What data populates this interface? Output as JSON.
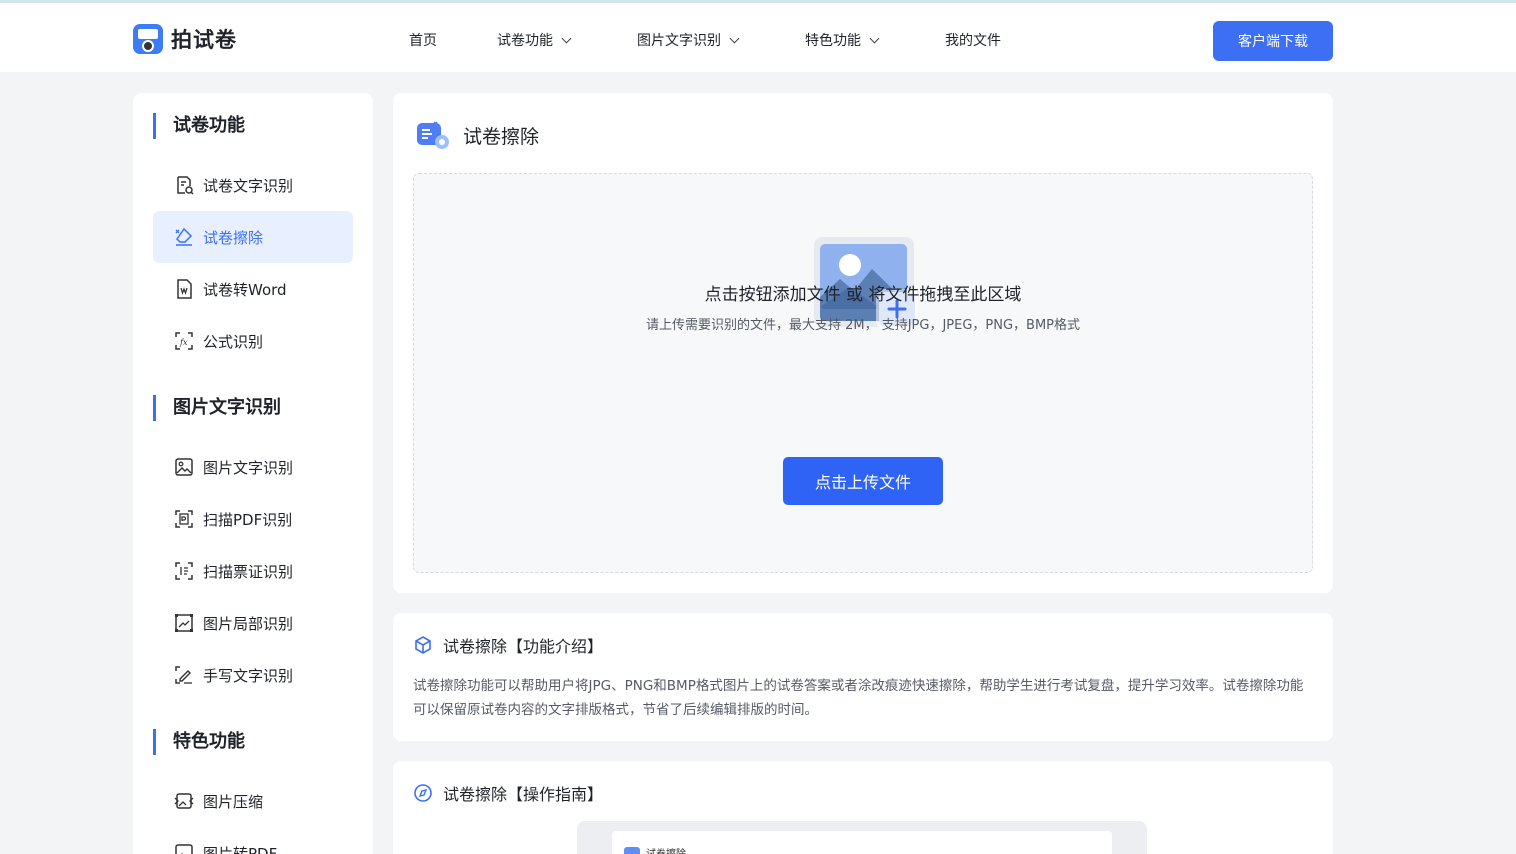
{
  "header": {
    "logo_text": "拍试卷",
    "nav": [
      {
        "label": "首页",
        "has_dropdown": false
      },
      {
        "label": "试卷功能",
        "has_dropdown": true
      },
      {
        "label": "图片文字识别",
        "has_dropdown": true
      },
      {
        "label": "特色功能",
        "has_dropdown": true
      },
      {
        "label": "我的文件",
        "has_dropdown": false
      }
    ],
    "download_button": "客户端下载"
  },
  "sidebar": {
    "groups": [
      {
        "title": "试卷功能",
        "items": [
          {
            "label": "试卷文字识别",
            "icon": "exam-text-icon",
            "active": false
          },
          {
            "label": "试卷擦除",
            "icon": "eraser-icon",
            "active": true
          },
          {
            "label": "试卷转Word",
            "icon": "word-icon",
            "active": false
          },
          {
            "label": "公式识别",
            "icon": "formula-icon",
            "active": false
          }
        ]
      },
      {
        "title": "图片文字识别",
        "items": [
          {
            "label": "图片文字识别",
            "icon": "image-text-icon",
            "active": false
          },
          {
            "label": "扫描PDF识别",
            "icon": "pdf-scan-icon",
            "active": false
          },
          {
            "label": "扫描票证识别",
            "icon": "ticket-scan-icon",
            "active": false
          },
          {
            "label": "图片局部识别",
            "icon": "partial-scan-icon",
            "active": false
          },
          {
            "label": "手写文字识别",
            "icon": "handwriting-icon",
            "active": false
          }
        ]
      },
      {
        "title": "特色功能",
        "items": [
          {
            "label": "图片压缩",
            "icon": "image-compress-icon",
            "active": false
          },
          {
            "label": "图片转PDF",
            "icon": "image-to-pdf-icon",
            "active": false
          }
        ]
      }
    ]
  },
  "upload": {
    "title": "试卷擦除",
    "hint_main": "点击按钮添加文件 或 将文件拖拽至此区域",
    "hint_sub": "请上传需要识别的文件，最大支持 2M， 支持JPG，JPEG，PNG，BMP格式",
    "button": "点击上传文件"
  },
  "intro": {
    "title": "试卷擦除【功能介绍】",
    "text": "试卷擦除功能可以帮助用户将JPG、PNG和BMP格式图片上的试卷答案或者涂改痕迹快速擦除，帮助学生进行考试复盘，提升学习效率。试卷擦除功能可以保留原试卷内容的文字排版格式，节省了后续编辑排版的时间。"
  },
  "guide": {
    "title": "试卷擦除【操作指南】",
    "preview_title": "试卷擦除"
  },
  "colors": {
    "accent": "#3d6ff5",
    "active_bg": "#e8effe"
  }
}
